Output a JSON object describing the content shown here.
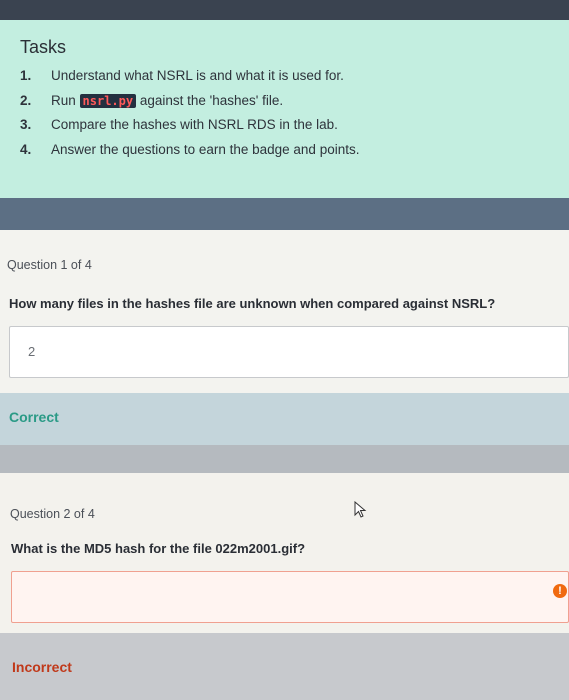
{
  "tasks": {
    "title": "Tasks",
    "items": [
      {
        "num": "1.",
        "before": "Understand what NSRL is and what it is used for.",
        "code": "",
        "after": ""
      },
      {
        "num": "2.",
        "before": "Run ",
        "code": "nsrl.py",
        "after": " against the 'hashes' file."
      },
      {
        "num": "3.",
        "before": "Compare the hashes with NSRL RDS in the lab.",
        "code": "",
        "after": ""
      },
      {
        "num": "4.",
        "before": "Answer the questions to earn the badge and points.",
        "code": "",
        "after": ""
      }
    ]
  },
  "question1": {
    "count": "Question 1 of 4",
    "text": "How many files in the hashes file are unknown when compared against NSRL?",
    "answer": "2",
    "result": "Correct",
    "result_color": "#2a9a86"
  },
  "question2": {
    "count": "Question 2 of 4",
    "text": "What is the MD5 hash for the file 022m2001.gif?",
    "answer": "",
    "result": "Incorrect",
    "result_color": "#c0391a",
    "error_icon": "!"
  },
  "colors": {
    "tasks_bg": "#c3eee0",
    "code_bg": "#243040",
    "code_fg": "#ff5a5a",
    "error_border": "#f0a090",
    "error_bg": "#fff4f1"
  }
}
